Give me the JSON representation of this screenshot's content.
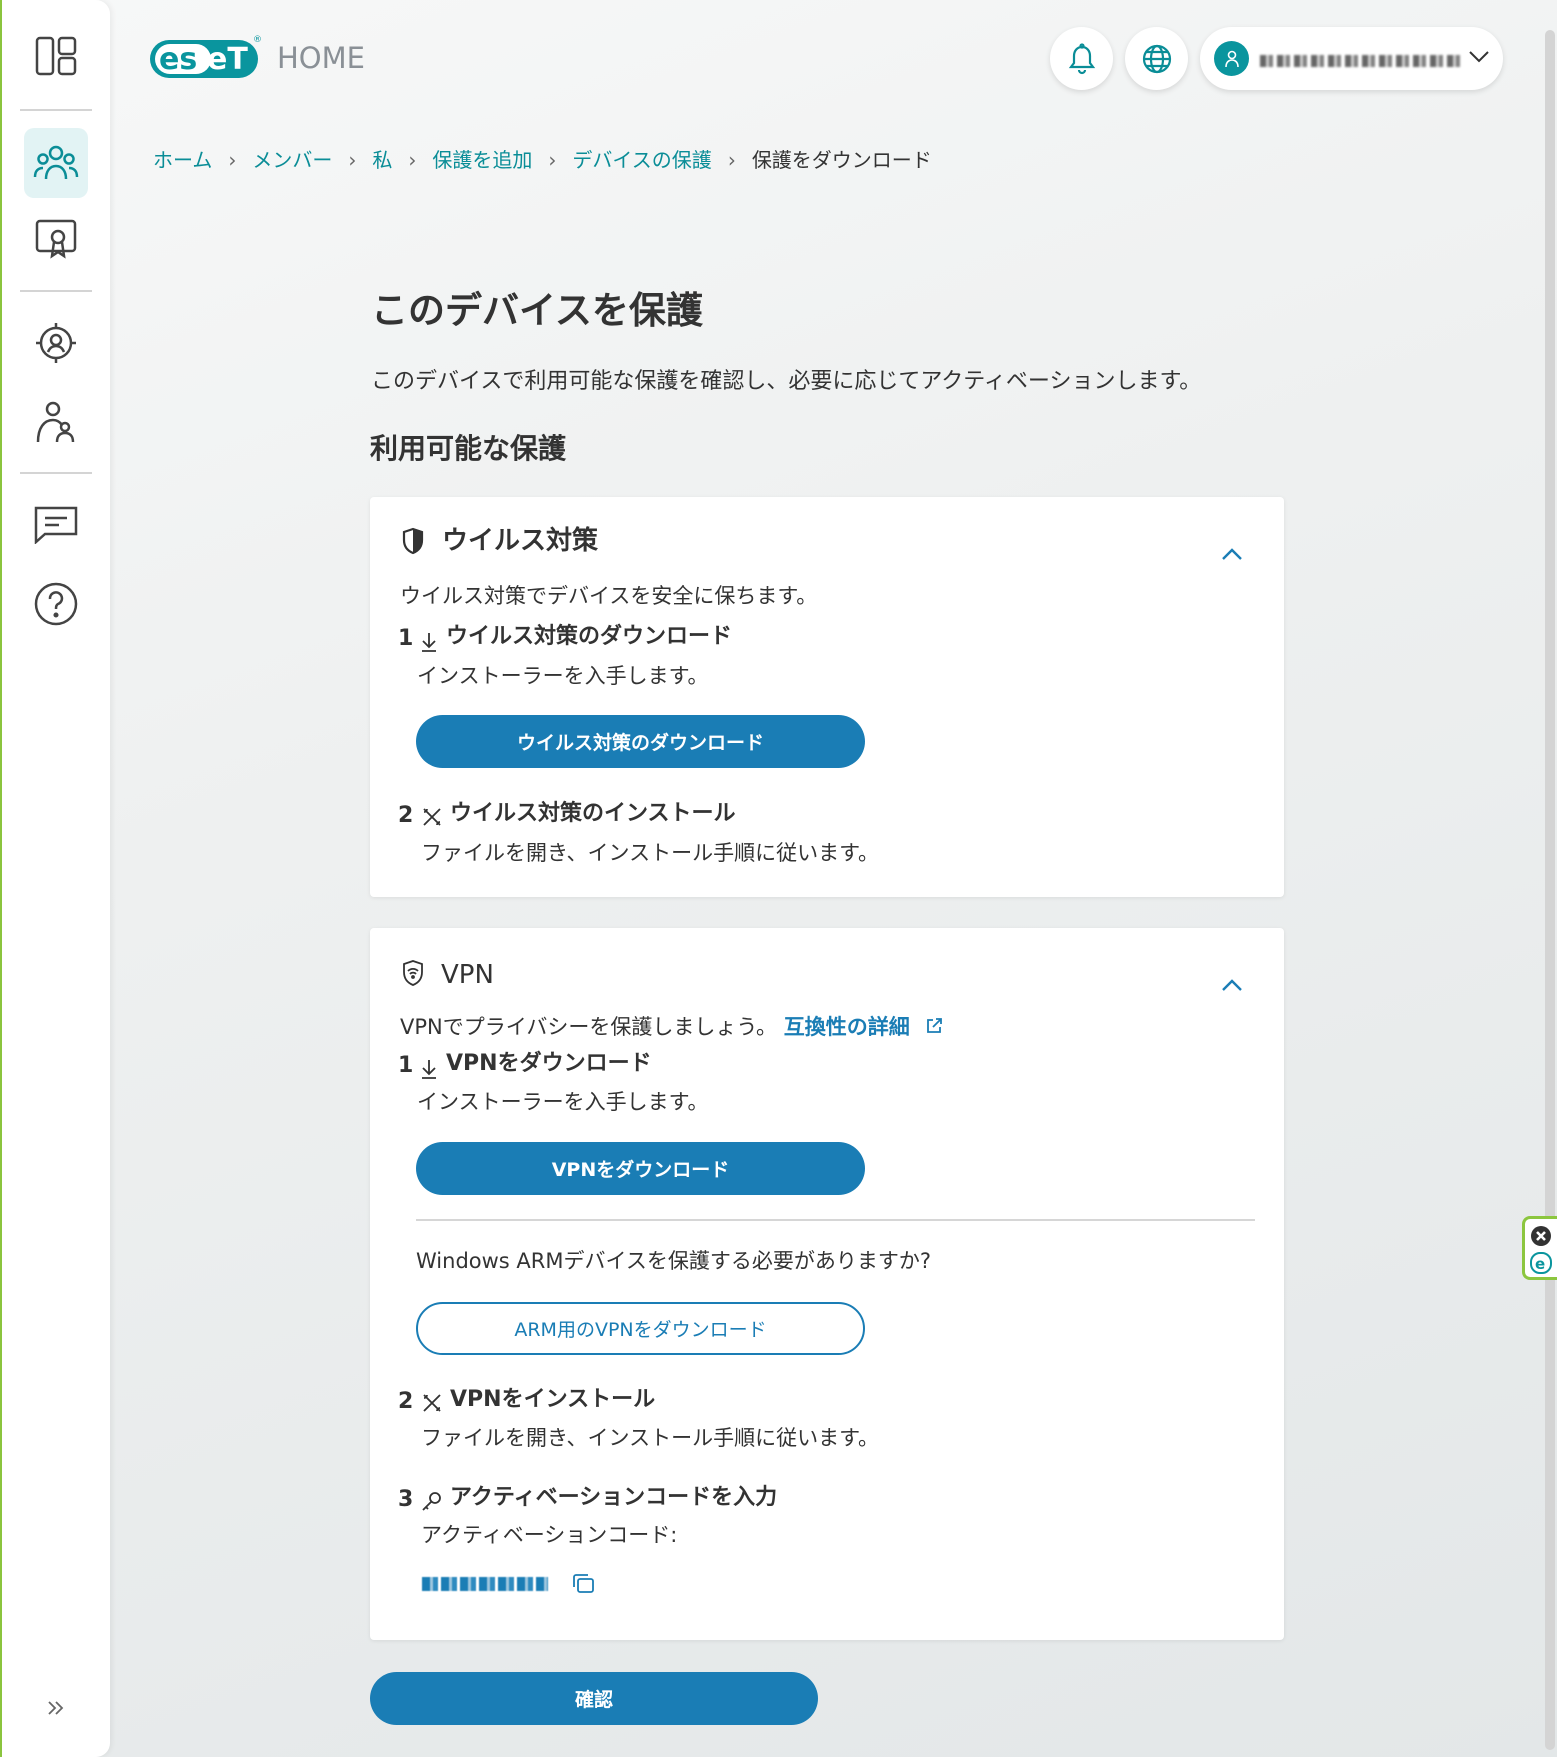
{
  "app": {
    "logo": "eset",
    "product": "HOME"
  },
  "header": {
    "notifications_icon": "bell-icon",
    "language_icon": "globe-icon",
    "user_name": "(redacted)"
  },
  "sidebar": {
    "items": [
      "dashboard",
      "members",
      "licenses",
      "security",
      "family",
      "messages",
      "help"
    ],
    "expand_icon": "double-chevron-right"
  },
  "breadcrumb": [
    "ホーム",
    "メンバー",
    "私",
    "保護を追加",
    "デバイスの保護",
    "保護をダウンロード"
  ],
  "page": {
    "title": "このデバイスを保護",
    "subtitle": "このデバイスで利用可能な保護を確認し、必要に応じてアクティベーションします。",
    "section": "利用可能な保護"
  },
  "antivirus": {
    "title": "ウイルス対策",
    "desc": "ウイルス対策でデバイスを安全に保ちます。",
    "step1_num": "1",
    "step1_title": "ウイルス対策のダウンロード",
    "step1_desc": "インストーラーを入手します。",
    "download_btn": "ウイルス対策のダウンロード",
    "step2_num": "2",
    "step2_title": "ウイルス対策のインストール",
    "step2_desc": "ファイルを開き、インストール手順に従います。"
  },
  "vpn": {
    "title": "VPN",
    "desc": "VPNでプライバシーを保護しましょう。",
    "compat_link": "互換性の詳細",
    "step1_num": "1",
    "step1_title": "VPNをダウンロード",
    "step1_desc": "インストーラーを入手します。",
    "download_btn": "VPNをダウンロード",
    "arm_question": "Windows ARMデバイスを保護する必要がありますか?",
    "arm_btn": "ARM用のVPNをダウンロード",
    "step2_num": "2",
    "step2_title": "VPNをインストール",
    "step2_desc": "ファイルを開き、インストール手順に従います。",
    "step3_num": "3",
    "step3_title": "アクティベーションコードを入力",
    "step3_desc": "アクティベーションコード:",
    "activation_code": "(redacted)"
  },
  "confirm_btn": "確認",
  "colors": {
    "accent": "#0a8d97",
    "button": "#1a7db5",
    "frame": "#8cc63f"
  }
}
